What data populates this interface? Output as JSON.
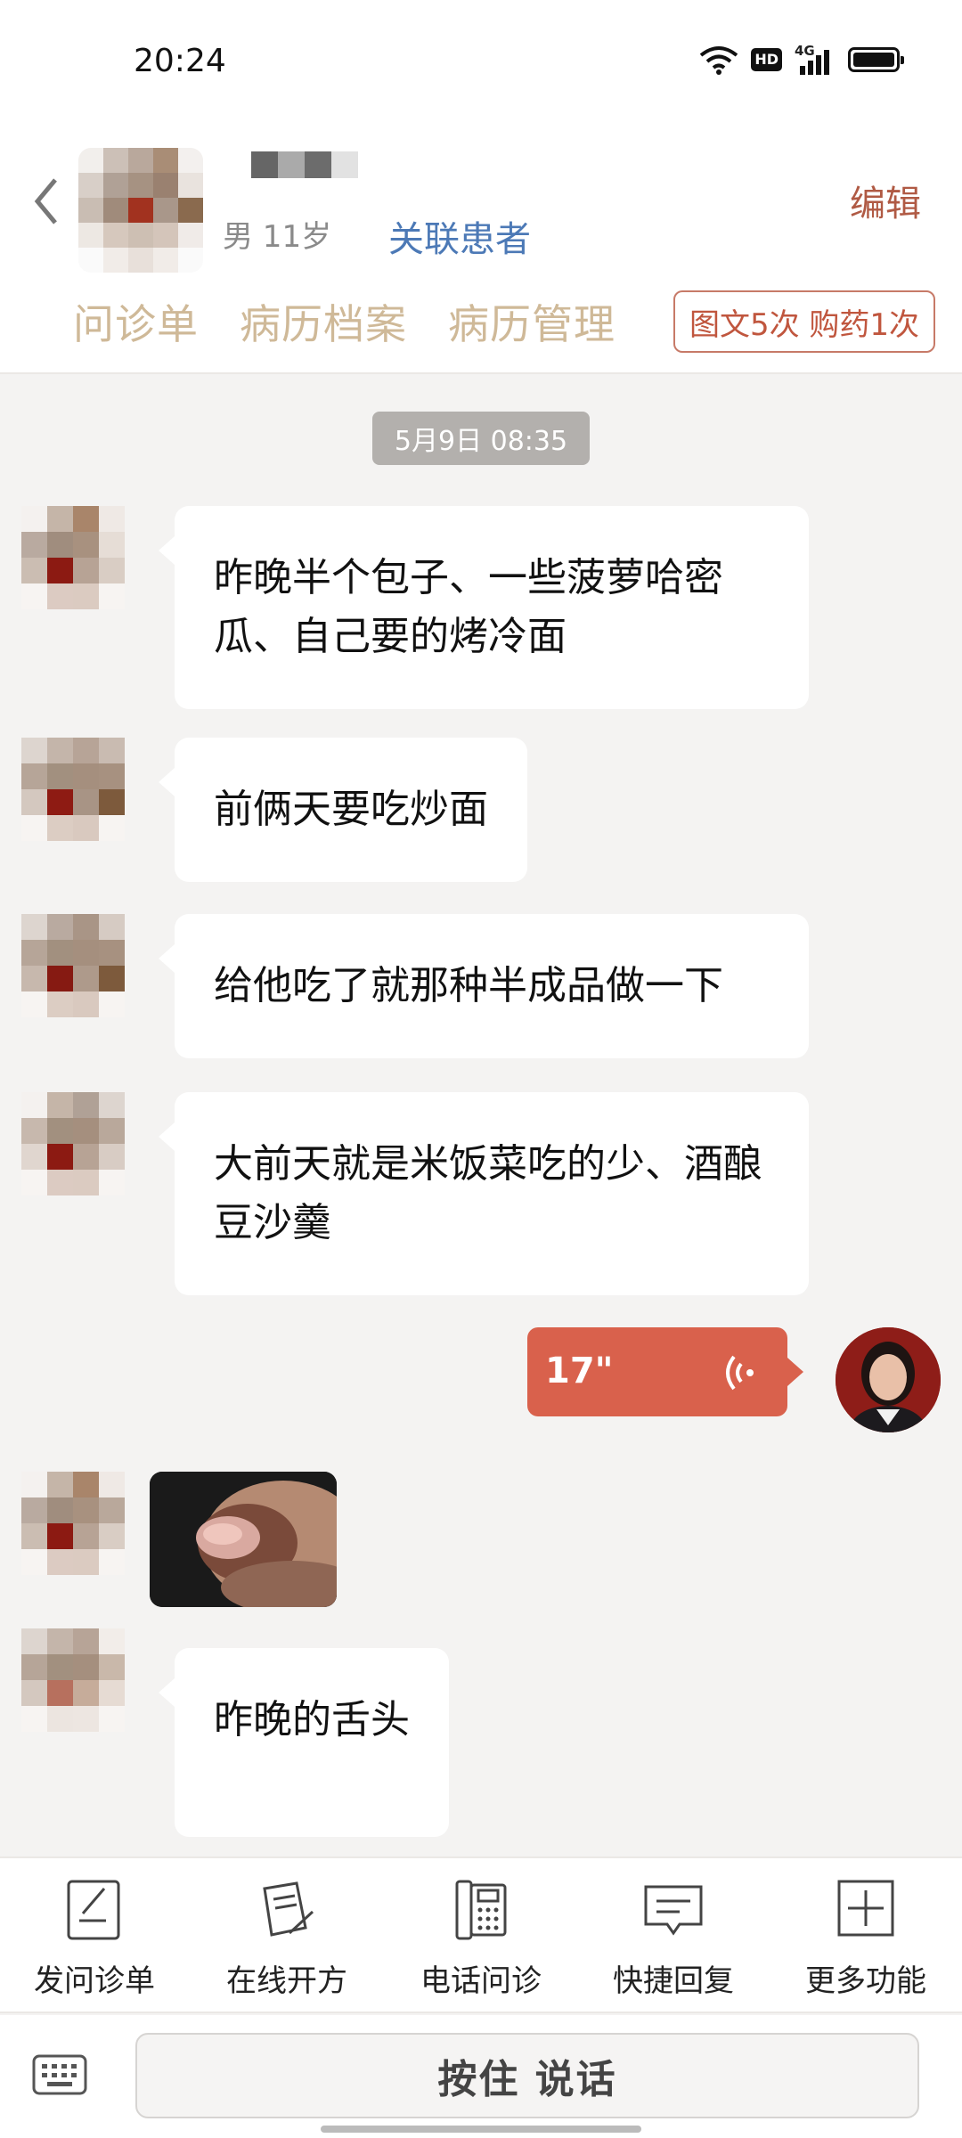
{
  "status_bar": {
    "time": "20:24",
    "hd": "HD",
    "network": "4G"
  },
  "header": {
    "gender_age": "男 11岁",
    "link_patient": "关联患者",
    "edit": "编辑",
    "tabs": [
      "问诊单",
      "病历档案",
      "病历管理"
    ],
    "quota": "图文5次 购药1次"
  },
  "chat": {
    "date": "5月9日 08:35",
    "messages": [
      {
        "text": "昨晚半个包子、一些菠萝哈密瓜、自己要的烤冷面"
      },
      {
        "text": "前俩天要吃炒面"
      },
      {
        "text": "给他吃了就那种半成品做一下"
      },
      {
        "text": "大前天就是米饭菜吃的少、酒酿豆沙羹"
      },
      {
        "text": "昨晚的舌头"
      }
    ],
    "voice_duration": "17\""
  },
  "toolbar": {
    "items": [
      {
        "label": "发问诊单",
        "icon": "form-icon"
      },
      {
        "label": "在线开方",
        "icon": "prescription-icon"
      },
      {
        "label": "电话问诊",
        "icon": "phone-icon"
      },
      {
        "label": "快捷回复",
        "icon": "quick-reply-icon"
      },
      {
        "label": "更多功能",
        "icon": "plus-icon"
      }
    ]
  },
  "input": {
    "hold_to_talk": "按住 说话"
  },
  "colors": {
    "accent": "#d9614c",
    "link": "#4c79b6",
    "tab": "#cfb998"
  }
}
